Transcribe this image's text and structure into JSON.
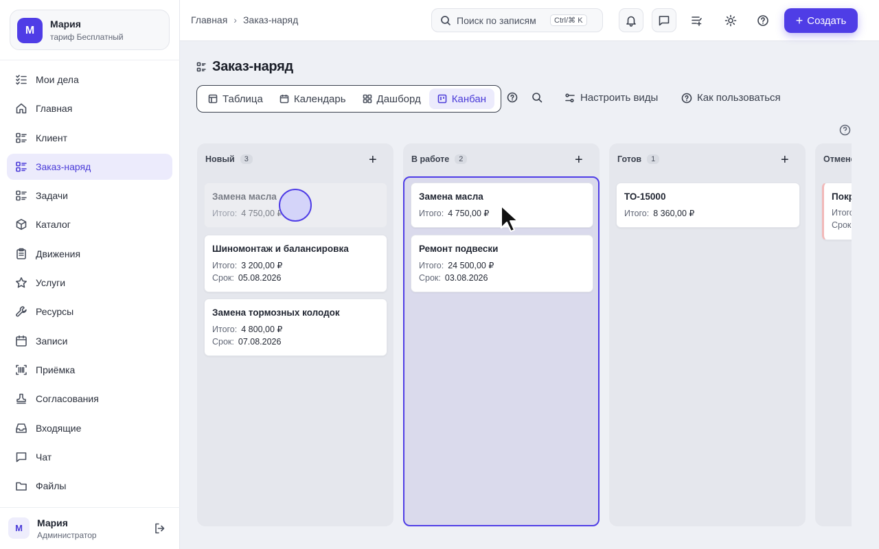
{
  "account": {
    "initial": "М",
    "name": "Мария",
    "plan": "тариф Бесплатный"
  },
  "nav": [
    {
      "label": "Мои дела",
      "icon": "task-list-icon"
    },
    {
      "label": "Главная",
      "icon": "home-icon"
    },
    {
      "label": "Клиент",
      "icon": "list-icon"
    },
    {
      "label": "Заказ-наряд",
      "icon": "list-icon",
      "active": true
    },
    {
      "label": "Задачи",
      "icon": "list-icon"
    },
    {
      "label": "Каталог",
      "icon": "box-icon"
    },
    {
      "label": "Движения",
      "icon": "clipboard-icon"
    },
    {
      "label": "Услуги",
      "icon": "star-icon"
    },
    {
      "label": "Ресурсы",
      "icon": "wrench-icon"
    },
    {
      "label": "Записи",
      "icon": "calendar-icon"
    },
    {
      "label": "Приёмка",
      "icon": "barcode-icon"
    },
    {
      "label": "Согласования",
      "icon": "stamp-icon"
    },
    {
      "label": "Входящие",
      "icon": "inbox-icon"
    },
    {
      "label": "Чат",
      "icon": "chat-icon"
    },
    {
      "label": "Файлы",
      "icon": "folder-icon"
    }
  ],
  "user": {
    "initial": "М",
    "name": "Мария",
    "role": "Администратор"
  },
  "breadcrumb": {
    "home": "Главная",
    "current": "Заказ-наряд"
  },
  "search": {
    "placeholder": "Поиск по записям",
    "shortcut": "Ctrl/⌘ K"
  },
  "create_label": "Создать",
  "page": {
    "title": "Заказ-наряд"
  },
  "views": [
    {
      "label": "Таблица",
      "icon": "table-icon"
    },
    {
      "label": "Календарь",
      "icon": "calendar-icon"
    },
    {
      "label": "Дашборд",
      "icon": "dashboard-icon"
    },
    {
      "label": "Канбан",
      "icon": "kanban-icon",
      "active": true
    }
  ],
  "tools": {
    "configure": "Настроить виды",
    "howto": "Как пользоваться"
  },
  "labels": {
    "total": "Итого:",
    "due": "Срок:"
  },
  "columns": [
    {
      "name": "Новый",
      "count": "3",
      "cards": [
        {
          "title": "Замена масла",
          "total": "4 750,00 ₽",
          "ghost": true
        },
        {
          "title": "Шиномонтаж и балансировка",
          "total": "3 200,00 ₽",
          "due": "05.08.2026"
        },
        {
          "title": "Замена тормозных колодок",
          "total": "4 800,00 ₽",
          "due": "07.08.2026"
        }
      ]
    },
    {
      "name": "В работе",
      "count": "2",
      "cards": [
        {
          "title": "Замена масла",
          "total": "4 750,00 ₽"
        },
        {
          "title": "Ремонт подвески",
          "total": "24 500,00 ₽",
          "due": "03.08.2026"
        }
      ]
    },
    {
      "name": "Готов",
      "count": "1",
      "cards": [
        {
          "title": "ТО-15000",
          "total": "8 360,00 ₽"
        }
      ]
    },
    {
      "name": "Отменён",
      "count": "",
      "cards": [
        {
          "title": "Покр",
          "total_label": "Итого",
          "due_label": "Срок:"
        }
      ]
    }
  ]
}
